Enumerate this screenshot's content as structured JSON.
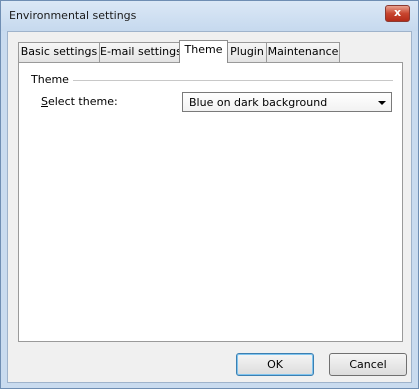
{
  "window": {
    "title": "Environmental settings",
    "close_label": "x"
  },
  "tabs": [
    {
      "label": "Basic settings",
      "active": false
    },
    {
      "label": "E-mail settings",
      "active": false
    },
    {
      "label": "Theme",
      "active": true
    },
    {
      "label": "Plugin",
      "active": false
    },
    {
      "label": "Maintenance",
      "active": false
    }
  ],
  "theme": {
    "group_label": "Theme",
    "select_label_accel": "S",
    "select_label_rest": "elect theme:",
    "selected_value": "Blue on dark background"
  },
  "buttons": {
    "ok": "OK",
    "cancel": "Cancel"
  }
}
